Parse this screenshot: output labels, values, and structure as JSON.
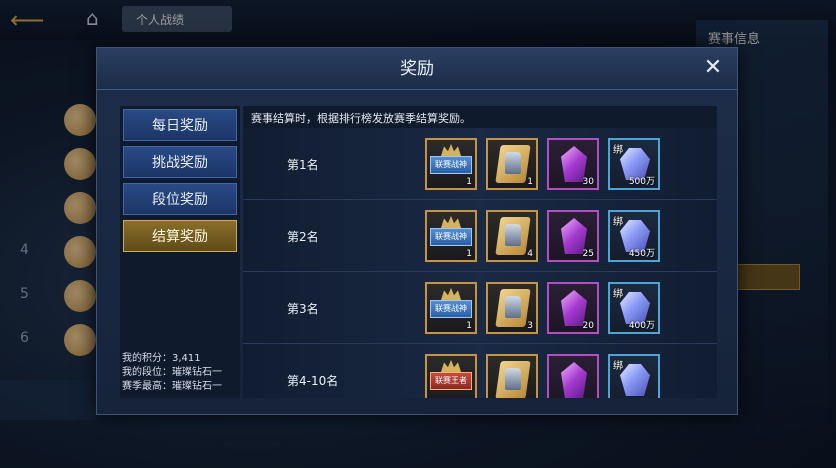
{
  "background": {
    "tab_label": "个人战绩",
    "right_title": "赛事信息",
    "left_ranks": [
      "",
      "",
      "",
      "4",
      "5",
      "6"
    ]
  },
  "modal": {
    "title": "奖励",
    "close_label": "✕"
  },
  "tabs": [
    {
      "label": "每日奖励",
      "active": false
    },
    {
      "label": "挑战奖励",
      "active": false
    },
    {
      "label": "段位奖励",
      "active": false
    },
    {
      "label": "结算奖励",
      "active": true
    }
  ],
  "stats": {
    "score": "我的积分：3,411",
    "rank": "我的段位：璀璨钻石一",
    "best": "赛季最高：璀璨钻石一"
  },
  "description": "赛事结算时，根据排行榜发放赛季结算奖励。",
  "rewards": [
    {
      "rank": "第1名",
      "badge_text": "联赛战神",
      "card_qty": "1",
      "badge_qty": "1",
      "crystal_qty": "30",
      "diamond_qty": "500万",
      "bound": "绑"
    },
    {
      "rank": "第2名",
      "badge_text": "联赛战神",
      "card_qty": "4",
      "badge_qty": "1",
      "crystal_qty": "25",
      "diamond_qty": "450万",
      "bound": "绑"
    },
    {
      "rank": "第3名",
      "badge_text": "联赛战神",
      "card_qty": "3",
      "badge_qty": "1",
      "crystal_qty": "20",
      "diamond_qty": "400万",
      "bound": "绑"
    },
    {
      "rank": "第4-10名",
      "badge_text": "联赛王者",
      "card_qty": "",
      "badge_qty": "",
      "crystal_qty": "",
      "diamond_qty": "",
      "bound": "绑"
    }
  ],
  "colors": {
    "gold_border": "#c5943f",
    "purple_border": "#b34fc1",
    "blue_border": "#4da4d8",
    "active_tab": "#8a6f2a",
    "inactive_tab": "#294a86"
  }
}
